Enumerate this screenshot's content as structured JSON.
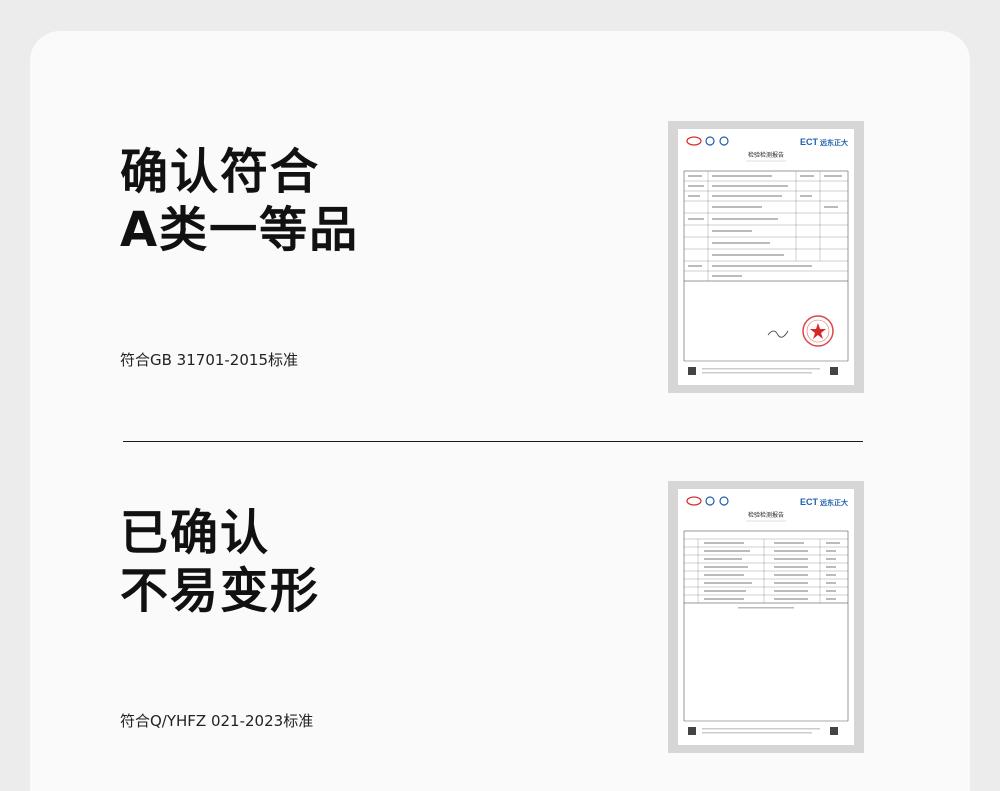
{
  "sections": [
    {
      "headline": [
        "确认符合",
        "A类一等品"
      ],
      "standard": "符合GB 31701-2015标准"
    },
    {
      "headline": [
        "已确认",
        "不易变形"
      ],
      "standard": "符合Q/YHFZ 021-2023标准"
    }
  ],
  "report": {
    "brand": "ECT",
    "brand_cn": "远东正大",
    "title": "检验检测报告"
  },
  "colors": {
    "page_bg": "#ececec",
    "card_bg": "#fafafa",
    "text": "#111111",
    "seal_red": "#d62828",
    "brand_blue": "#1f5fae"
  }
}
